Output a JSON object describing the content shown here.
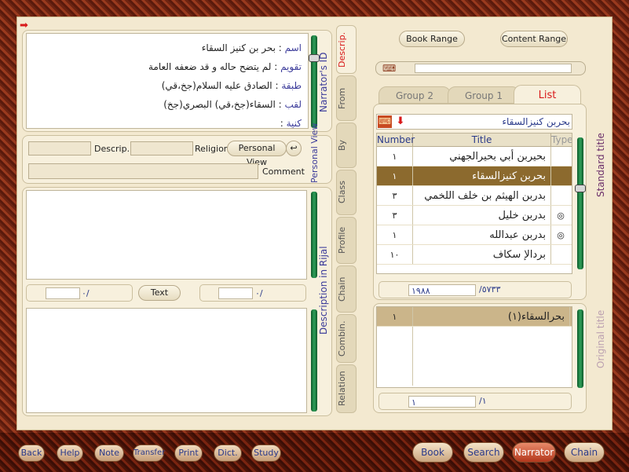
{
  "narrator_info": {
    "name_label": "اسم",
    "name_value": "بحر بن كنيز السقاء",
    "evaluation_label": "تقويم",
    "evaluation_value": "لم يتضح حاله و قد ضعفه العامة",
    "class_label": "طبقة",
    "class_value": "الصادق عليه السلام(جخ،قي)",
    "title_label": "لقب",
    "title_value": "السقاء(جخ،قي) البصري(جخ)",
    "kunya_label": "كنية",
    "kunya_value": ""
  },
  "side_labels": {
    "narrators_id": "Narrator's ID",
    "personal_view": "Personal View",
    "description_in_rijal": "Description in Rijal",
    "standard_title": "Standard title",
    "original_title": "Original title"
  },
  "personal_view": {
    "descrip_label": "Descrip.",
    "religion_label": "Religion",
    "button_label": "Personal View",
    "comment_label": "Comment"
  },
  "page_counters": {
    "left_value": "٠/",
    "text_button": "Text",
    "right_value": "٠/"
  },
  "vertical_tabs": [
    "Descrip.",
    "From",
    "By",
    "Class",
    "Profile",
    "Chain",
    "Combin.",
    "Relation"
  ],
  "top_buttons": {
    "book_range": "Book Range",
    "content_range": "Content Range"
  },
  "group_tabs": {
    "group2": "Group 2",
    "group1": "Group 1",
    "list": "List"
  },
  "list": {
    "search_value": "بحربن كنيزالسقاء",
    "headers": {
      "number": "Number",
      "title": "Title",
      "type": "Type"
    },
    "rows": [
      {
        "number": "١",
        "title": "بحيربن أبي بحيرالجهني",
        "type": ""
      },
      {
        "number": "١",
        "title": "بحربن كنيزالسقاء",
        "type": ""
      },
      {
        "number": "٣",
        "title": "بدربن الهيثم بن خلف اللخمي",
        "type": ""
      },
      {
        "number": "٣",
        "title": "بدربن خليل",
        "type": "◎"
      },
      {
        "number": "١",
        "title": "بدربن عبدالله",
        "type": "◎"
      },
      {
        "number": "١٠",
        "title": "بردالإ سكاف",
        "type": ""
      }
    ],
    "counter_current": "١٩٨٨",
    "counter_total": "/٥٧٣٣"
  },
  "original": {
    "rows": [
      {
        "number": "١",
        "title": "بحرالسقاء(١)"
      }
    ],
    "counter_current": "١",
    "counter_total": "/١"
  },
  "bottom_nav": {
    "back": "Back",
    "help": "Help",
    "note": "Note",
    "transfer": "Transfer",
    "print": "Print",
    "dict": "Dict.",
    "study": "Study",
    "book": "Book",
    "search": "Search",
    "narrator": "Narrator",
    "chain": "Chain"
  },
  "colors": {
    "accent": "#8c6a2e",
    "list_tab": "#d8191a",
    "label_blue": "#3b3b9a"
  }
}
